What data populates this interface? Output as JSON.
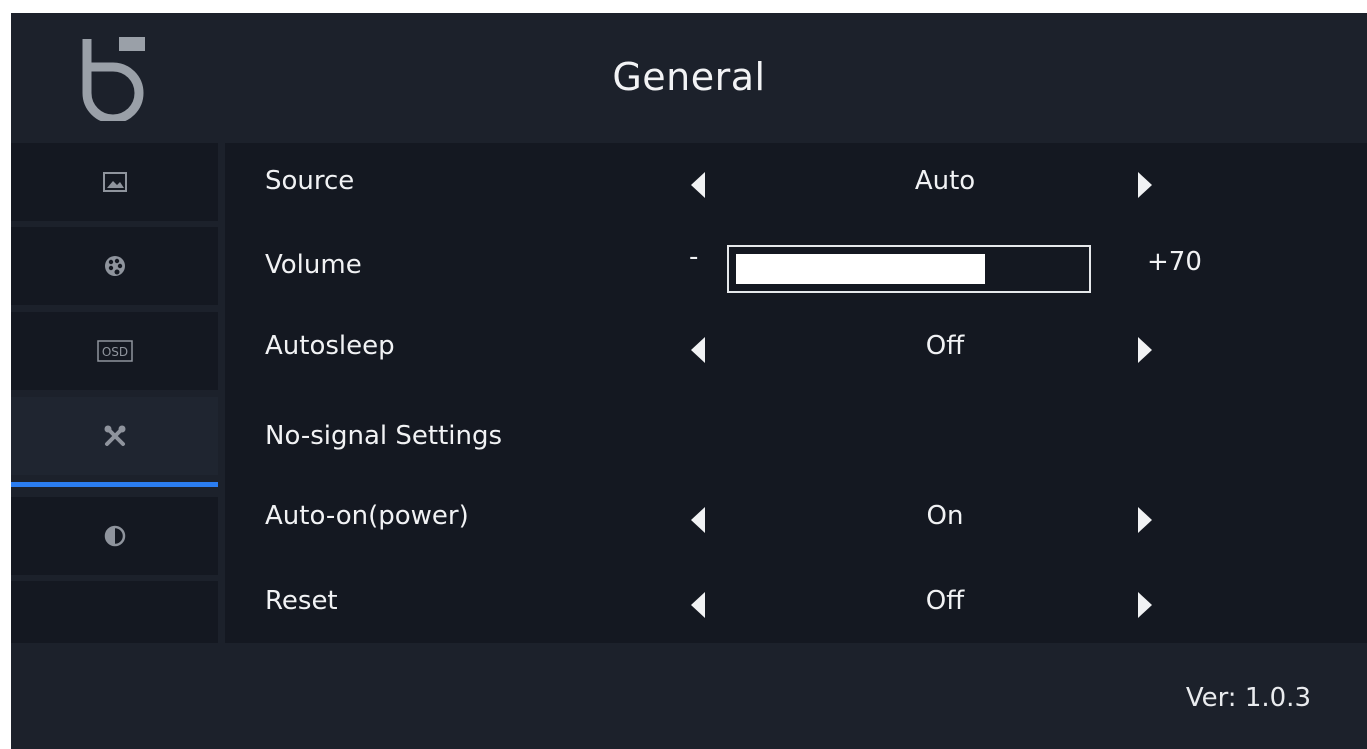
{
  "header": {
    "title": "General",
    "logo_icon": "logo-icon"
  },
  "sidebar": {
    "items": [
      {
        "id": "picture",
        "icon": "picture-icon",
        "active": false
      },
      {
        "id": "color",
        "icon": "palette-icon",
        "active": false
      },
      {
        "id": "osd",
        "icon": "osd-icon",
        "icon_text": "OSD",
        "active": false
      },
      {
        "id": "general",
        "icon": "tools-icon",
        "active": true
      },
      {
        "id": "contrast",
        "icon": "contrast-icon",
        "active": false
      },
      {
        "id": "empty",
        "icon": "",
        "active": false
      }
    ],
    "accent_color": "#2b7df0"
  },
  "settings": {
    "rows": [
      {
        "label": "Source",
        "type": "select",
        "value": "Auto"
      },
      {
        "label": "Volume",
        "type": "slider",
        "min_label": "-",
        "value": "+70",
        "level": 0.72
      },
      {
        "label": "Autosleep",
        "type": "select",
        "value": "Off"
      },
      {
        "label": "No-signal Settings",
        "type": "submenu"
      },
      {
        "label": "Auto-on(power)",
        "type": "select",
        "value": "On"
      },
      {
        "label": "Reset",
        "type": "select",
        "value": "Off"
      }
    ]
  },
  "footer": {
    "version": "Ver: 1.0.3"
  }
}
